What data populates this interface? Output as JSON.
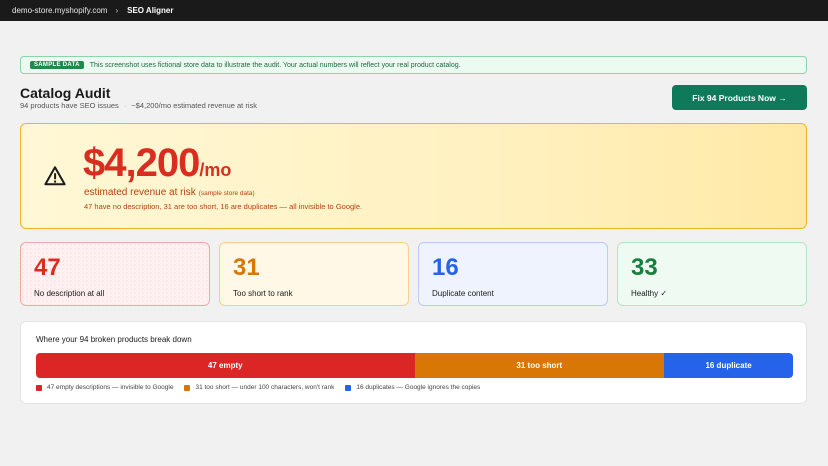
{
  "topbar": {
    "store": "demo-store.myshopify.com",
    "separator": "›",
    "app": "SEO Aligner"
  },
  "banner": {
    "badge": "SAMPLE DATA",
    "text": "This screenshot uses fictional store data to illustrate the audit. Your actual numbers will reflect your real product catalog."
  },
  "header": {
    "title": "Catalog Audit",
    "subtitle_count": "94 products have SEO issues",
    "subtitle_dot": "·",
    "subtitle_revenue": "~$4,200/mo estimated revenue at risk",
    "fix_button": "Fix 94 Products Now →"
  },
  "hero": {
    "amount": "$4,200",
    "per": "/mo",
    "label": "estimated revenue at risk",
    "label_note": "(sample store data)",
    "detail": "47 have no description, 31 are too short, 16 are duplicates — all invisible to Google."
  },
  "cards": [
    {
      "value": "47",
      "label": "No description at all"
    },
    {
      "value": "31",
      "label": "Too short to rank"
    },
    {
      "value": "16",
      "label": "Duplicate content"
    },
    {
      "value": "33",
      "label": "Healthy ✓"
    }
  ],
  "breakdown": {
    "heading": "Where your 94 broken products break down",
    "segments": [
      {
        "label": "47 empty",
        "value": 47,
        "color": "#dc2626"
      },
      {
        "label": "31 too short",
        "value": 31,
        "color": "#d97706"
      },
      {
        "label": "16 duplicate",
        "value": 16,
        "color": "#2563eb"
      }
    ],
    "legend": [
      {
        "text": "47 empty descriptions — invisible to Google",
        "color": "#dc2626"
      },
      {
        "text": "31 too short — under 100 characters, won't rank",
        "color": "#d97706"
      },
      {
        "text": "16 duplicates — Google ignores the copies",
        "color": "#2563eb"
      }
    ]
  }
}
